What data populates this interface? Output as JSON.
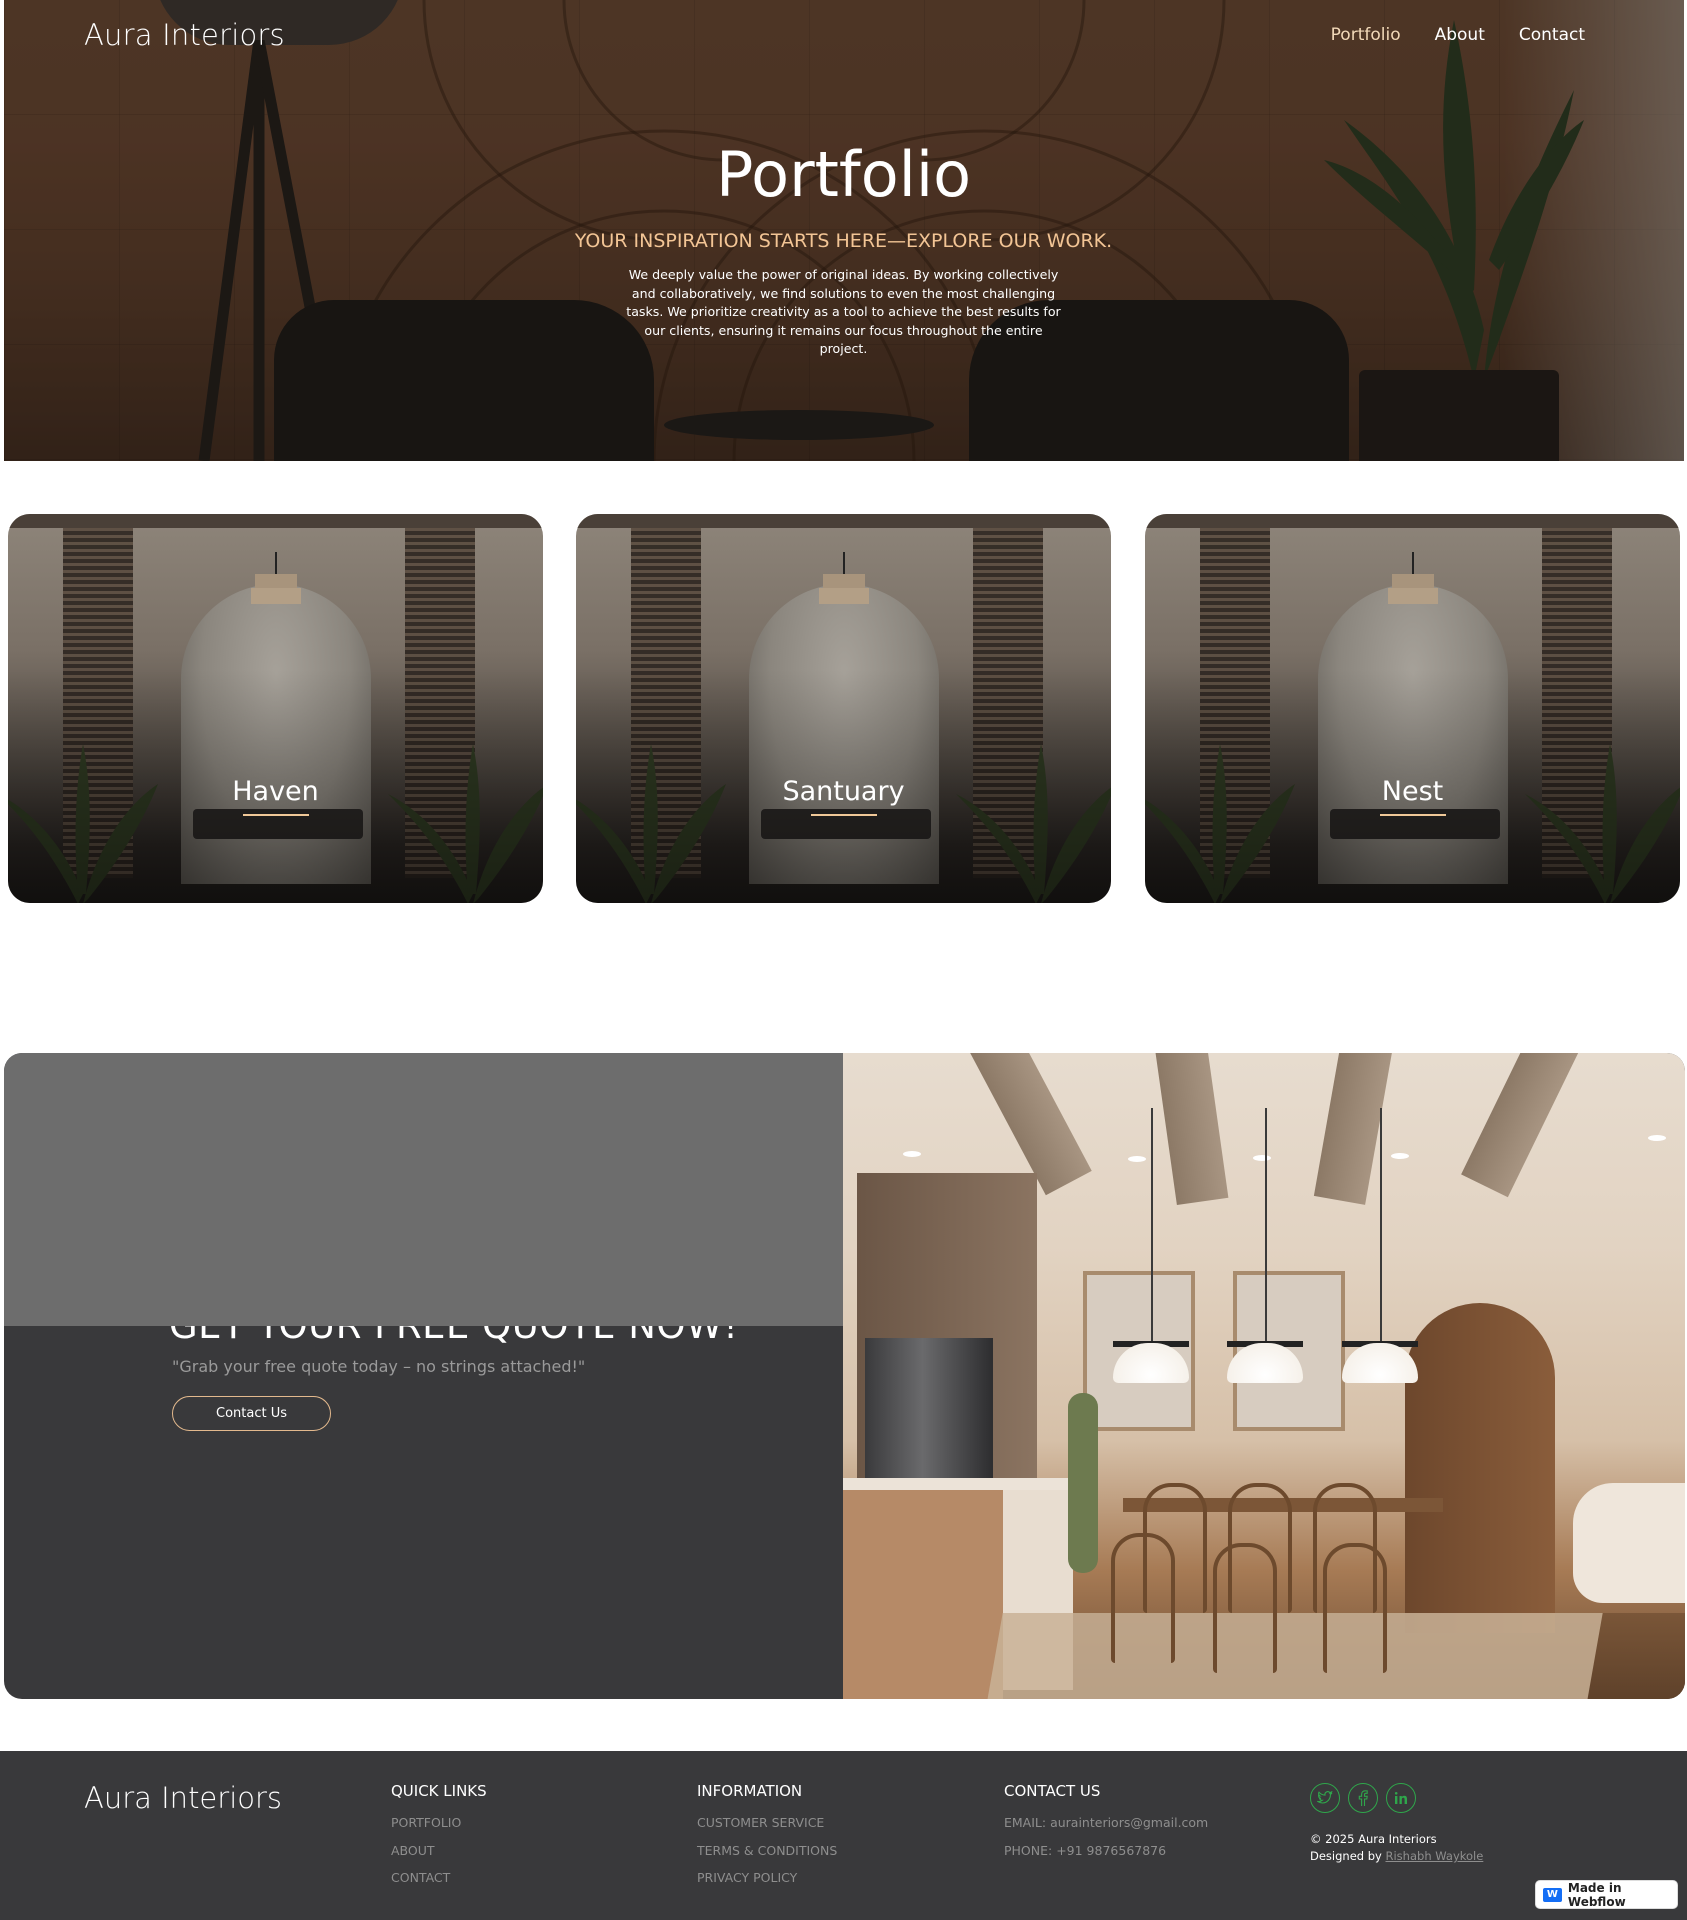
{
  "brand": {
    "name": "Aura Interiors"
  },
  "nav": {
    "items": [
      "Portfolio",
      "About",
      "Contact"
    ],
    "active": "Portfolio"
  },
  "hero": {
    "title": "Portfolio",
    "subtitle": "YOUR INSPIRATION STARTS HERE—EXPLORE OUR WORK.",
    "description": "We deeply value the power of original ideas. By working collectively and collaboratively, we find solutions to even the most challenging tasks. We prioritize creativity as a tool to achieve the best results for our clients, ensuring it remains our focus throughout the entire project."
  },
  "projects": [
    {
      "title": "Haven"
    },
    {
      "title": "Santuary"
    },
    {
      "title": "Nest"
    }
  ],
  "quote": {
    "title": "GET YOUR FREE QUOTE NOW!",
    "subtitle": "\"Grab your free quote today – no strings attached!\"",
    "button_label": "Contact Us"
  },
  "footer": {
    "logo": "Aura Interiors",
    "quick_links": {
      "heading": "QUICK LINKS",
      "items": [
        "PORTFOLIO",
        "ABOUT",
        "CONTACT"
      ]
    },
    "information": {
      "heading": "INFORMATION",
      "items": [
        "CUSTOMER SERVICE",
        "TERMS & CONDITIONS",
        "PRIVACY POLICY"
      ]
    },
    "contact": {
      "heading": "CONTACT US",
      "email": "EMAIL: aurainteriors@gmail.com",
      "phone": "PHONE: +91 9876567876"
    },
    "social_icons": [
      "twitter-icon",
      "facebook-icon",
      "linkedin-icon"
    ],
    "copyright": "© 2025 Aura Interiors",
    "designed_by_label": "Designed by",
    "designer": "Rishabh Waykole",
    "badge": "Made in Webflow"
  },
  "colors": {
    "accent": "#f3c595",
    "button_border": "#e3b98d",
    "social": "#2fa64b",
    "dark_bg": "#39393b"
  }
}
